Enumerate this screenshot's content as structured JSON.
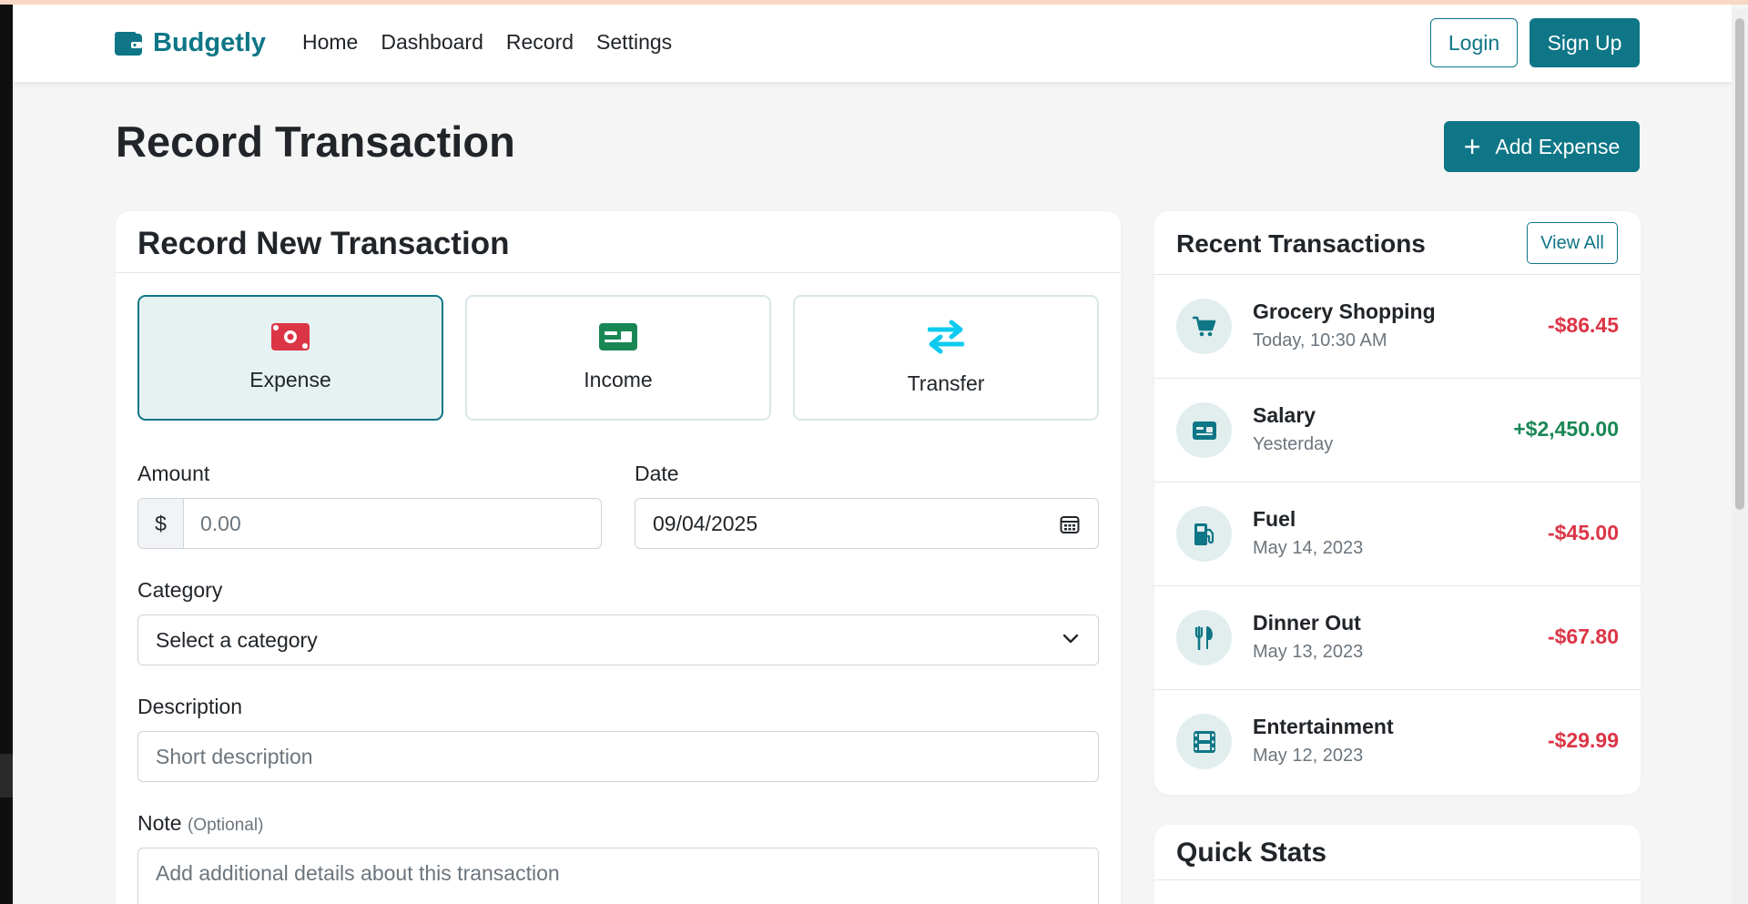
{
  "brand": {
    "name": "Budgetly",
    "color": "#0e7686",
    "icon": "wallet-icon"
  },
  "nav": {
    "links": [
      "Home",
      "Dashboard",
      "Record",
      "Settings"
    ],
    "login": "Login",
    "signup": "Sign Up"
  },
  "page": {
    "title": "Record Transaction",
    "add_expense": "Add Expense",
    "add_icon": "plus-icon"
  },
  "form": {
    "title": "Record New Transaction",
    "types": [
      {
        "label": "Expense",
        "icon": "money-bill-icon",
        "color": "#dc3545",
        "active": true
      },
      {
        "label": "Income",
        "icon": "money-check-icon",
        "color": "#198754",
        "active": false
      },
      {
        "label": "Transfer",
        "icon": "exchange-arrows-icon",
        "color": "#0dcaf0",
        "active": false
      }
    ],
    "amount": {
      "label": "Amount",
      "currency": "$",
      "placeholder": "0.00"
    },
    "date": {
      "label": "Date",
      "value": "09/04/2025",
      "icon": "calendar-icon"
    },
    "category": {
      "label": "Category",
      "value": "Select a category",
      "icon": "chevron-down-icon"
    },
    "description": {
      "label": "Description",
      "placeholder": "Short description"
    },
    "note": {
      "label": "Note",
      "optional": "(Optional)",
      "placeholder": "Add additional details about this transaction"
    }
  },
  "recent": {
    "title": "Recent Transactions",
    "view_all": "View All",
    "items": [
      {
        "name": "Grocery Shopping",
        "date": "Today, 10:30 AM",
        "amount": "-$86.45",
        "type": "expense",
        "icon": "cart-icon"
      },
      {
        "name": "Salary",
        "date": "Yesterday",
        "amount": "+$2,450.00",
        "type": "income",
        "icon": "money-check-icon"
      },
      {
        "name": "Fuel",
        "date": "May 14, 2023",
        "amount": "-$45.00",
        "type": "expense",
        "icon": "gas-pump-icon"
      },
      {
        "name": "Dinner Out",
        "date": "May 13, 2023",
        "amount": "-$67.80",
        "type": "expense",
        "icon": "utensils-icon"
      },
      {
        "name": "Entertainment",
        "date": "May 12, 2023",
        "amount": "-$29.99",
        "type": "expense",
        "icon": "film-icon"
      }
    ]
  },
  "stats": {
    "title": "Quick Stats"
  }
}
